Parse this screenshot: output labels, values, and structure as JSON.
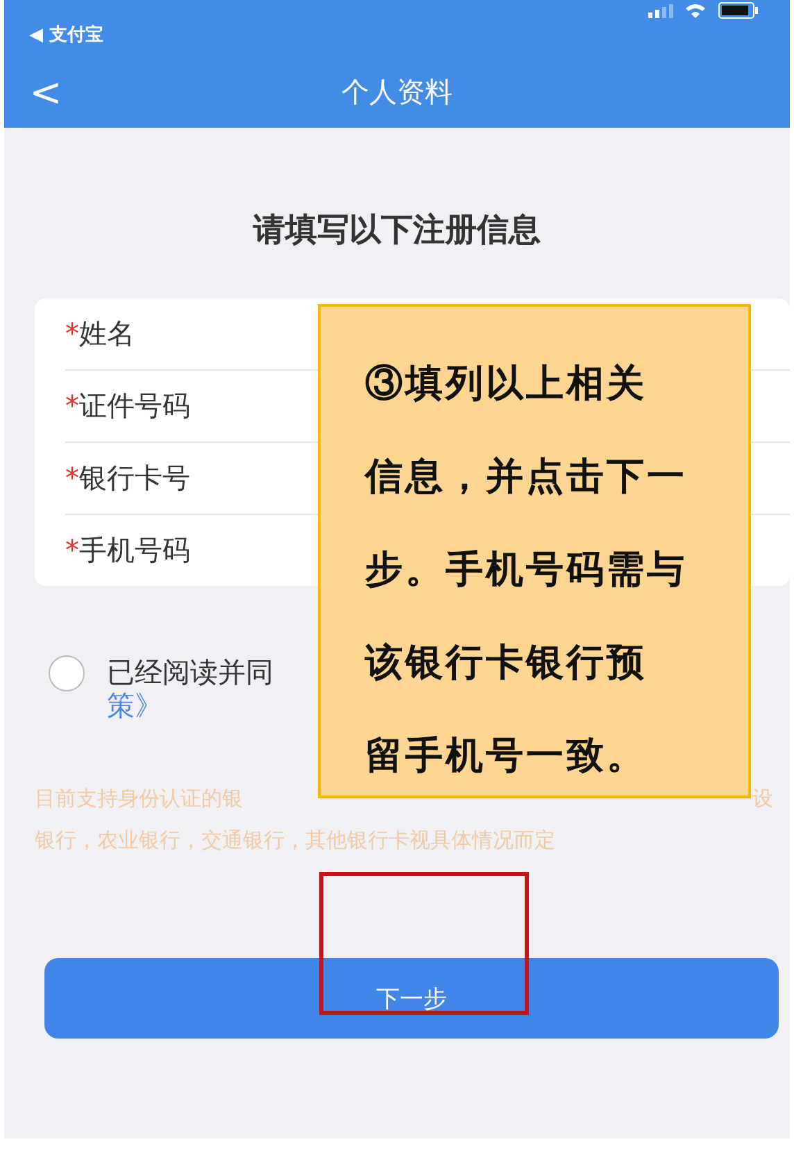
{
  "status_bar": {
    "back_app": "◀ 支付宝"
  },
  "nav_bar": {
    "back": "<",
    "title": "个人资料"
  },
  "heading": "请填写以下注册信息",
  "form": {
    "fields": [
      {
        "label": "姓名",
        "required_mark": "*"
      },
      {
        "label": "证件号码",
        "required_mark": "*"
      },
      {
        "label": "银行卡号",
        "required_mark": "*"
      },
      {
        "label": "手机号码",
        "required_mark": "*"
      }
    ]
  },
  "agreement": {
    "checked": false,
    "text": "已经阅读并同",
    "link": "策》"
  },
  "notice": {
    "line_1_start": "目前支持身份认证的银",
    "line_1_end": "设",
    "line_2": "银行，农业银行，交通银行，其他银行卡视具体情况而定"
  },
  "next_button": "下一步",
  "callout": {
    "lines": [
      "③填列以上相关",
      "信息，并点击下一",
      "步。手机号码需与",
      "该银行卡银行预",
      "留手机号一致。"
    ]
  }
}
